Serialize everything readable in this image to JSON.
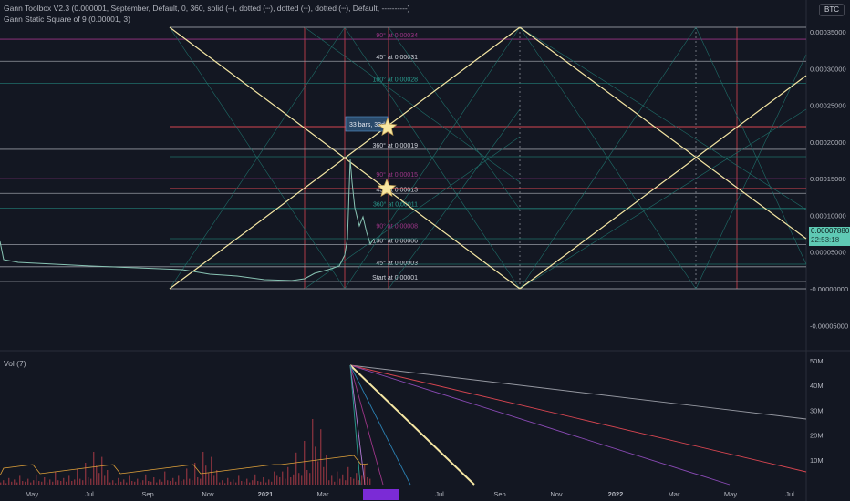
{
  "indicators": {
    "line1": "Gann Toolbox V2.3 (0.000001, September, Default, 0, 360, solid (–), dotted (┄), dotted (┄), dotted (┄), Default, ----------)",
    "line2": "Gann Static Square of 9 (0.00001, 3)",
    "vol_label": "Vol (7)"
  },
  "currency_badge": "BTC",
  "last_price": {
    "value": "0.00007880",
    "countdown": "22:53:18"
  },
  "colors": {
    "background": "#131722",
    "price_line": "#89c4b4",
    "gann_yellow": "#f5e6a3",
    "gann_teal": "#1f6f6a",
    "gann_red": "#d64550",
    "magenta": "#9c3587",
    "last_price_bg": "#5fc9b4"
  },
  "chart_data": [
    {
      "type": "line",
      "name": "price",
      "y_axis_labels": [
        "0.00035000",
        "0.00030000",
        "0.00025000",
        "0.00020000",
        "0.00015000",
        "0.00010000",
        "0.00005000",
        "-0.00000000",
        "-0.00005000"
      ],
      "y_axis_values": [
        0.00035,
        0.0003,
        0.00025,
        0.0002,
        0.00015,
        0.0001,
        5e-05,
        0,
        -5e-05
      ],
      "x_axis_labels": [
        "May",
        "Jul",
        "Sep",
        "Nov",
        "2021",
        "Mar",
        "May",
        "Jul",
        "Sep",
        "Nov",
        "2022",
        "Mar",
        "May",
        "Jul"
      ],
      "gann_levels": [
        {
          "label": "90° at 0.00034",
          "value": 0.00034,
          "color": "magenta"
        },
        {
          "label": "45° at 0.00031",
          "value": 0.00031,
          "color": "white"
        },
        {
          "label": "180° at 0.00028",
          "value": 0.00028,
          "color": "teal"
        },
        {
          "label": "360° at 0.00019",
          "value": 0.00019,
          "color": "white"
        },
        {
          "label": "90° at 0.00015",
          "value": 0.00015,
          "color": "magenta"
        },
        {
          "label": "45° at 0.00013",
          "value": 0.00013,
          "color": "white"
        },
        {
          "label": "360° at 0.00011",
          "value": 0.00011,
          "color": "teal"
        },
        {
          "label": "90° at 0.00008",
          "value": 8e-05,
          "color": "magenta"
        },
        {
          "label": "180° at 0.00006",
          "value": 6e-05,
          "color": "white"
        },
        {
          "label": "45° at 0.00003",
          "value": 3e-05,
          "color": "white"
        },
        {
          "label": "Start at 0.00001",
          "value": 1e-05,
          "color": "white"
        }
      ],
      "tooltip": "33 bars, 33d",
      "last_value": 7.88e-05
    },
    {
      "type": "bar",
      "name": "volume",
      "y_axis_labels": [
        "50M",
        "40M",
        "30M",
        "20M",
        "10M"
      ],
      "y_axis_values": [
        50000000,
        40000000,
        30000000,
        20000000,
        10000000
      ],
      "x_axis_labels": [
        "May",
        "Jul",
        "Sep",
        "Nov",
        "2021",
        "Mar",
        "May",
        "Jul",
        "Sep",
        "Nov",
        "2022",
        "Mar",
        "May",
        "Jul"
      ]
    }
  ]
}
